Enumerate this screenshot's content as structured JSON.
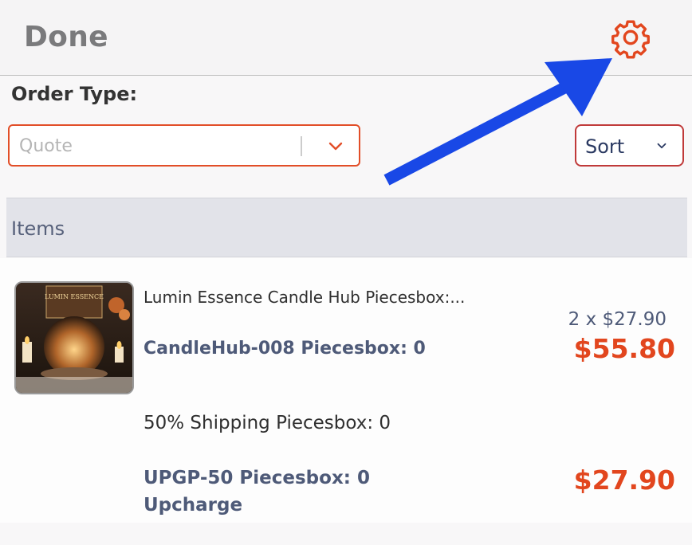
{
  "header": {
    "done_label": "Done",
    "settings_icon": "gear-icon"
  },
  "order_type": {
    "label": "Order Type:",
    "placeholder": "Quote",
    "chevron_icon": "chevron-down-icon"
  },
  "sort": {
    "label": "Sort",
    "chevron_icon": "chevron-down-icon"
  },
  "items_section": {
    "title": "Items"
  },
  "items": [
    {
      "image_logo_text": "LUMIN ESSENCE",
      "title": "Lumin Essence Candle Hub Piecesbox:...",
      "sku_line": "CandleHub-008 Piecesbox: 0",
      "qty_line": "2 x $27.90",
      "total": "$55.80"
    }
  ],
  "shipping_line": "50% Shipping Piecesbox: 0",
  "upcharge": {
    "sku_line": "UPGP-50 Piecesbox: 0",
    "label": "Upcharge",
    "total": "$27.90"
  },
  "colors": {
    "accent": "#e24e28",
    "price": "#e2461e",
    "arrow": "#1948e6",
    "text_blue": "#4e5a78"
  }
}
